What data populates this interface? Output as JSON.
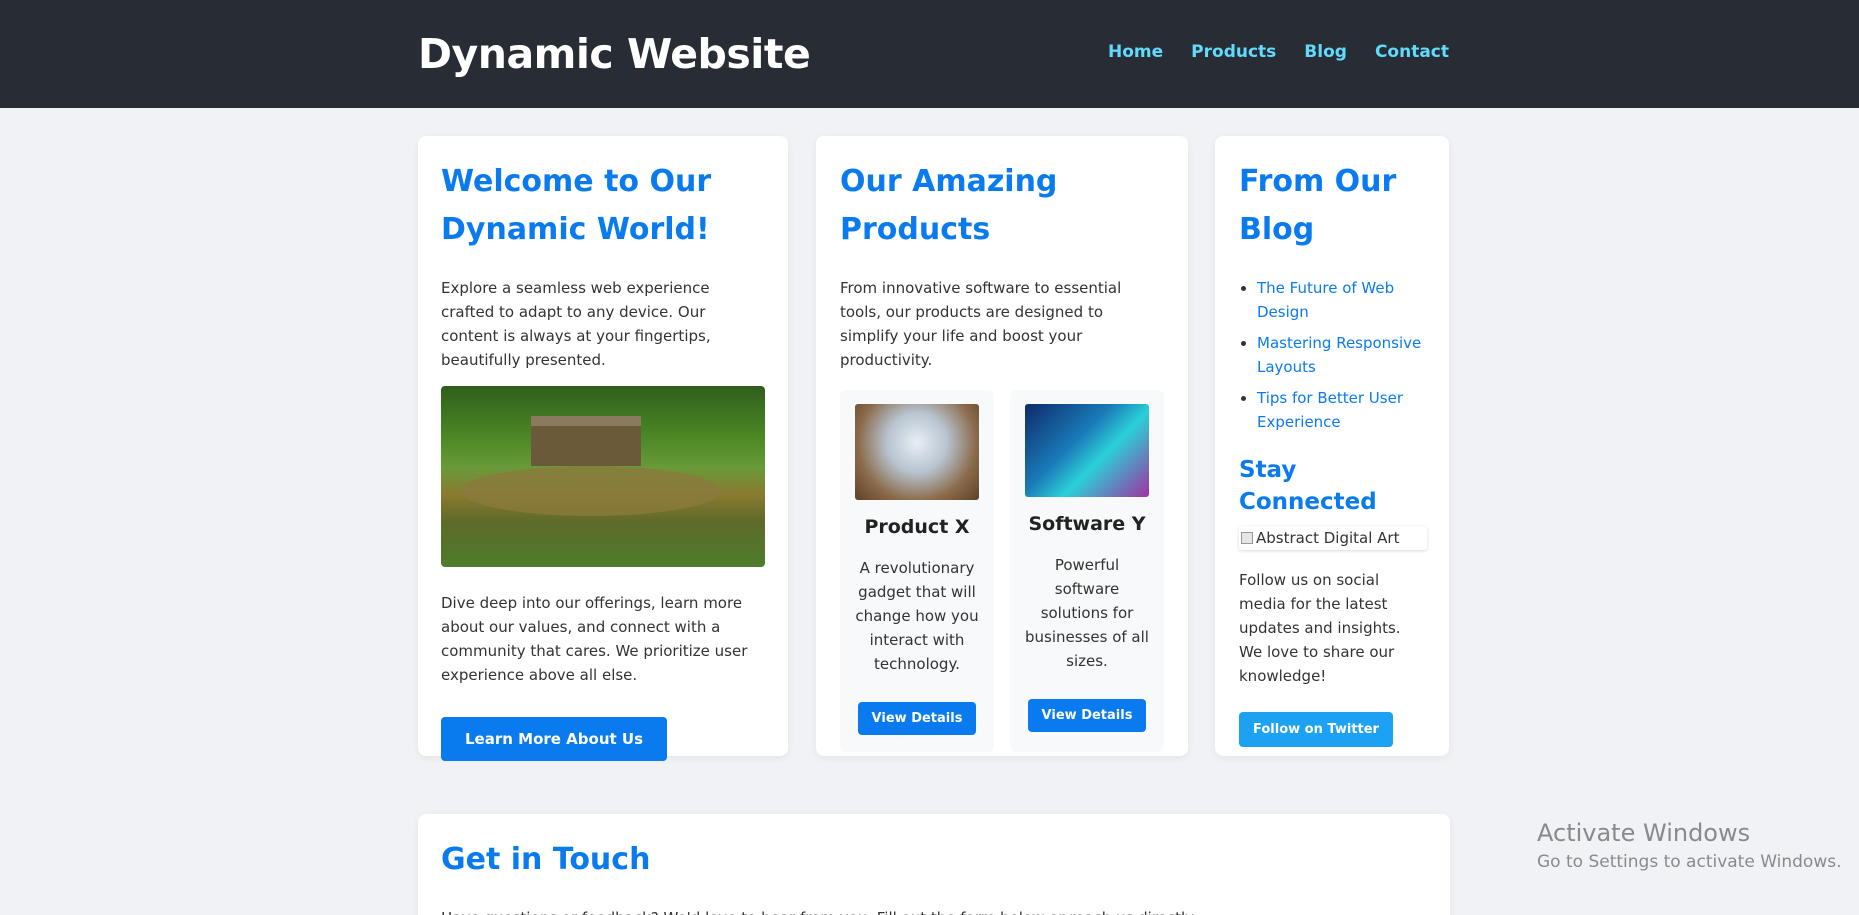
{
  "header": {
    "title": "Dynamic Website",
    "nav": [
      "Home",
      "Products",
      "Blog",
      "Contact"
    ]
  },
  "welcome": {
    "heading": "Welcome to Our Dynamic World!",
    "intro": "Explore a seamless web experience crafted to adapt to any device. Our content is always at your fingertips, beautifully presented.",
    "more": "Dive deep into our offerings, learn more about our values, and connect with a community that cares. We prioritize user experience above all else.",
    "button": "Learn More About Us"
  },
  "products": {
    "heading": "Our Amazing Products",
    "lead": "From innovative software to essential tools, our products are designed to simplify your life and boost your productivity.",
    "items": [
      {
        "name": "Product X",
        "desc": "A revolutionary gadget that will change how you interact with technology.",
        "button": "View Details"
      },
      {
        "name": "Software Y",
        "desc": "Powerful software solutions for businesses of all sizes.",
        "button": "View Details"
      }
    ]
  },
  "blog": {
    "heading": "From Our Blog",
    "posts": [
      "The Future of Web Design",
      "Mastering Responsive Layouts",
      "Tips for Better User Experience"
    ],
    "connect_heading": "Stay Connected",
    "image_alt": "Abstract Digital Art",
    "follow_text": "Follow us on social media for the latest updates and insights. We love to share our knowledge!",
    "follow_button": "Follow on Twitter"
  },
  "contact": {
    "heading": "Get in Touch",
    "text": "Have questions or feedback? We'd love to hear from you. Fill out the form below or reach us directly."
  },
  "watermark": {
    "title": "Activate Windows",
    "subtitle": "Go to Settings to activate Windows."
  },
  "colors": {
    "header_bg": "#282c34",
    "nav_link": "#61dafb",
    "accent": "#0a7bef",
    "twitter": "#1da1f2",
    "page_bg": "#f0f2f5"
  }
}
